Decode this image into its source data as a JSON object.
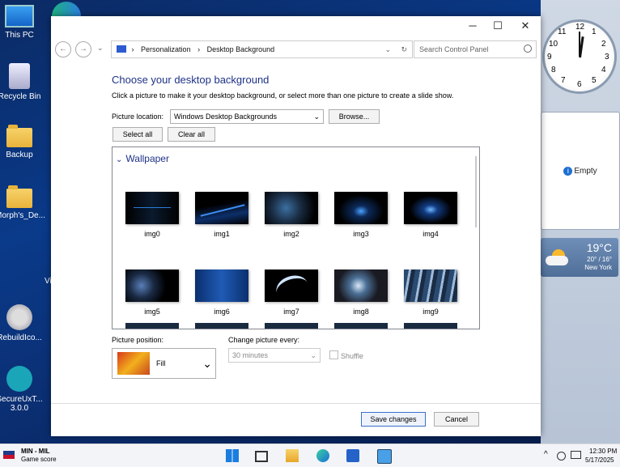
{
  "desktop": {
    "icons": [
      "This PC",
      "Recycle Bin",
      "Backup",
      "Morph's_De...",
      "RebuildIco...",
      "SecureUxT... 3.0.0"
    ],
    "partial_label": "Vi"
  },
  "gadgets": {
    "clock_numbers": [
      "12",
      "1",
      "2",
      "3",
      "4",
      "5",
      "6",
      "7",
      "8",
      "9",
      "10",
      "11"
    ],
    "empty_label": "Empty",
    "weather": {
      "temp": "19°C",
      "range": "20° / 16°",
      "city": "New York"
    }
  },
  "window": {
    "breadcrumb": [
      "Personalization",
      "Desktop Background"
    ],
    "search_placeholder": "Search Control Panel",
    "heading": "Choose your desktop background",
    "description": "Click a picture to make it your desktop background, or select more than one picture to create a slide show.",
    "picture_location_label": "Picture location:",
    "picture_location_value": "Windows Desktop Backgrounds",
    "browse_label": "Browse...",
    "select_all_label": "Select all",
    "clear_all_label": "Clear all",
    "group_label": "Wallpaper",
    "images": [
      "img0",
      "img1",
      "img2",
      "img3",
      "img4",
      "img5",
      "img6",
      "img7",
      "img8",
      "img9"
    ],
    "picture_position_label": "Picture position:",
    "picture_position_value": "Fill",
    "change_every_label": "Change picture every:",
    "change_every_value": "30 minutes",
    "shuffle_label": "Shuffle",
    "save_label": "Save changes",
    "cancel_label": "Cancel"
  },
  "taskbar": {
    "widget_title": "MIN - MIL",
    "widget_sub": "Game score",
    "time": "12:30 PM",
    "date": "5/17/2025"
  }
}
